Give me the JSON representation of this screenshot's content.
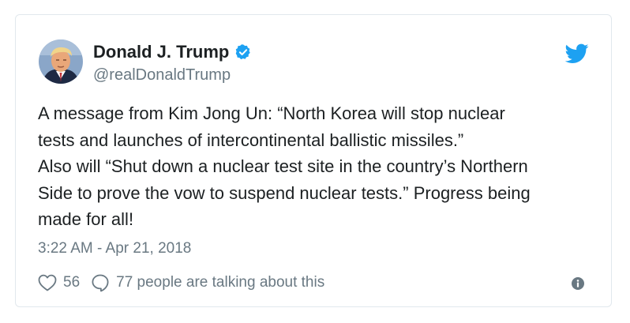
{
  "tweet": {
    "author_name": "Donald J. Trump",
    "author_handle": "@realDonaldTrump",
    "text": "A message from Kim Jong Un: “North Korea will stop nuclear\ntests and launches of intercontinental ballistic missiles.”\nAlso will “Shut down a nuclear test site in the country’s Northern\nSide to prove the vow to suspend nuclear tests.” Progress being\nmade for all!",
    "timestamp": "3:22 AM - Apr 21, 2018",
    "like_count": "56",
    "talking_text": "77 people are talking about this"
  },
  "icons": {
    "verified": "verified-badge-icon",
    "brand": "twitter-bird-icon",
    "like": "heart-icon",
    "reply": "reply-bubble-icon",
    "info": "info-icon"
  },
  "colors": {
    "brand_blue": "#1da1f2",
    "text": "#1c2022",
    "muted": "#697882",
    "border": "#e1e8ed"
  }
}
